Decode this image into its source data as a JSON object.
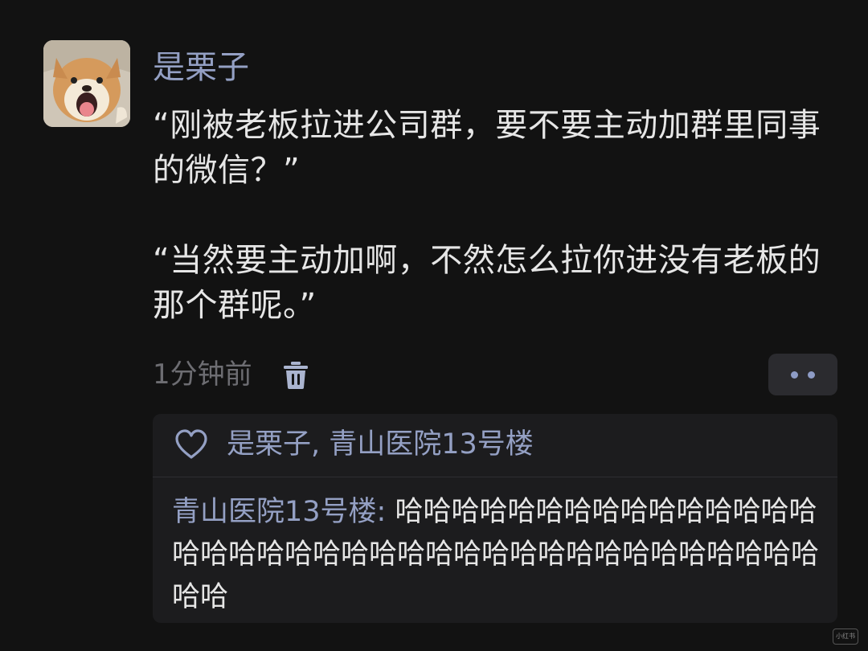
{
  "post": {
    "author": "是栗子",
    "paragraphs": [
      "“刚被老板拉进公司群，要不要主动加群里同事的微信？”",
      "“当然要主动加啊，不然怎么拉你进没有老板的那个群呢。”"
    ],
    "timestamp": "1分钟前",
    "delete_icon": "trash-icon",
    "more_icon": "more-dots-icon",
    "avatar_icon": "shiba-dog-avatar"
  },
  "interactions": {
    "like_icon": "heart-outline-icon",
    "likers": "是栗子, 青山医院13号楼",
    "comments": [
      {
        "author": "青山医院13号楼",
        "separator": ": ",
        "text": "哈哈哈哈哈哈哈哈哈哈哈哈哈哈哈哈哈哈哈哈哈哈哈哈哈哈哈哈哈哈哈哈哈哈哈哈哈哈哈哈"
      }
    ]
  },
  "watermark": "小红书",
  "colors": {
    "background": "#121212",
    "name_accent": "#94a0c4",
    "body_text": "#e6e6e6",
    "muted_text": "#6d6d72",
    "panel": "#1c1c1e"
  }
}
